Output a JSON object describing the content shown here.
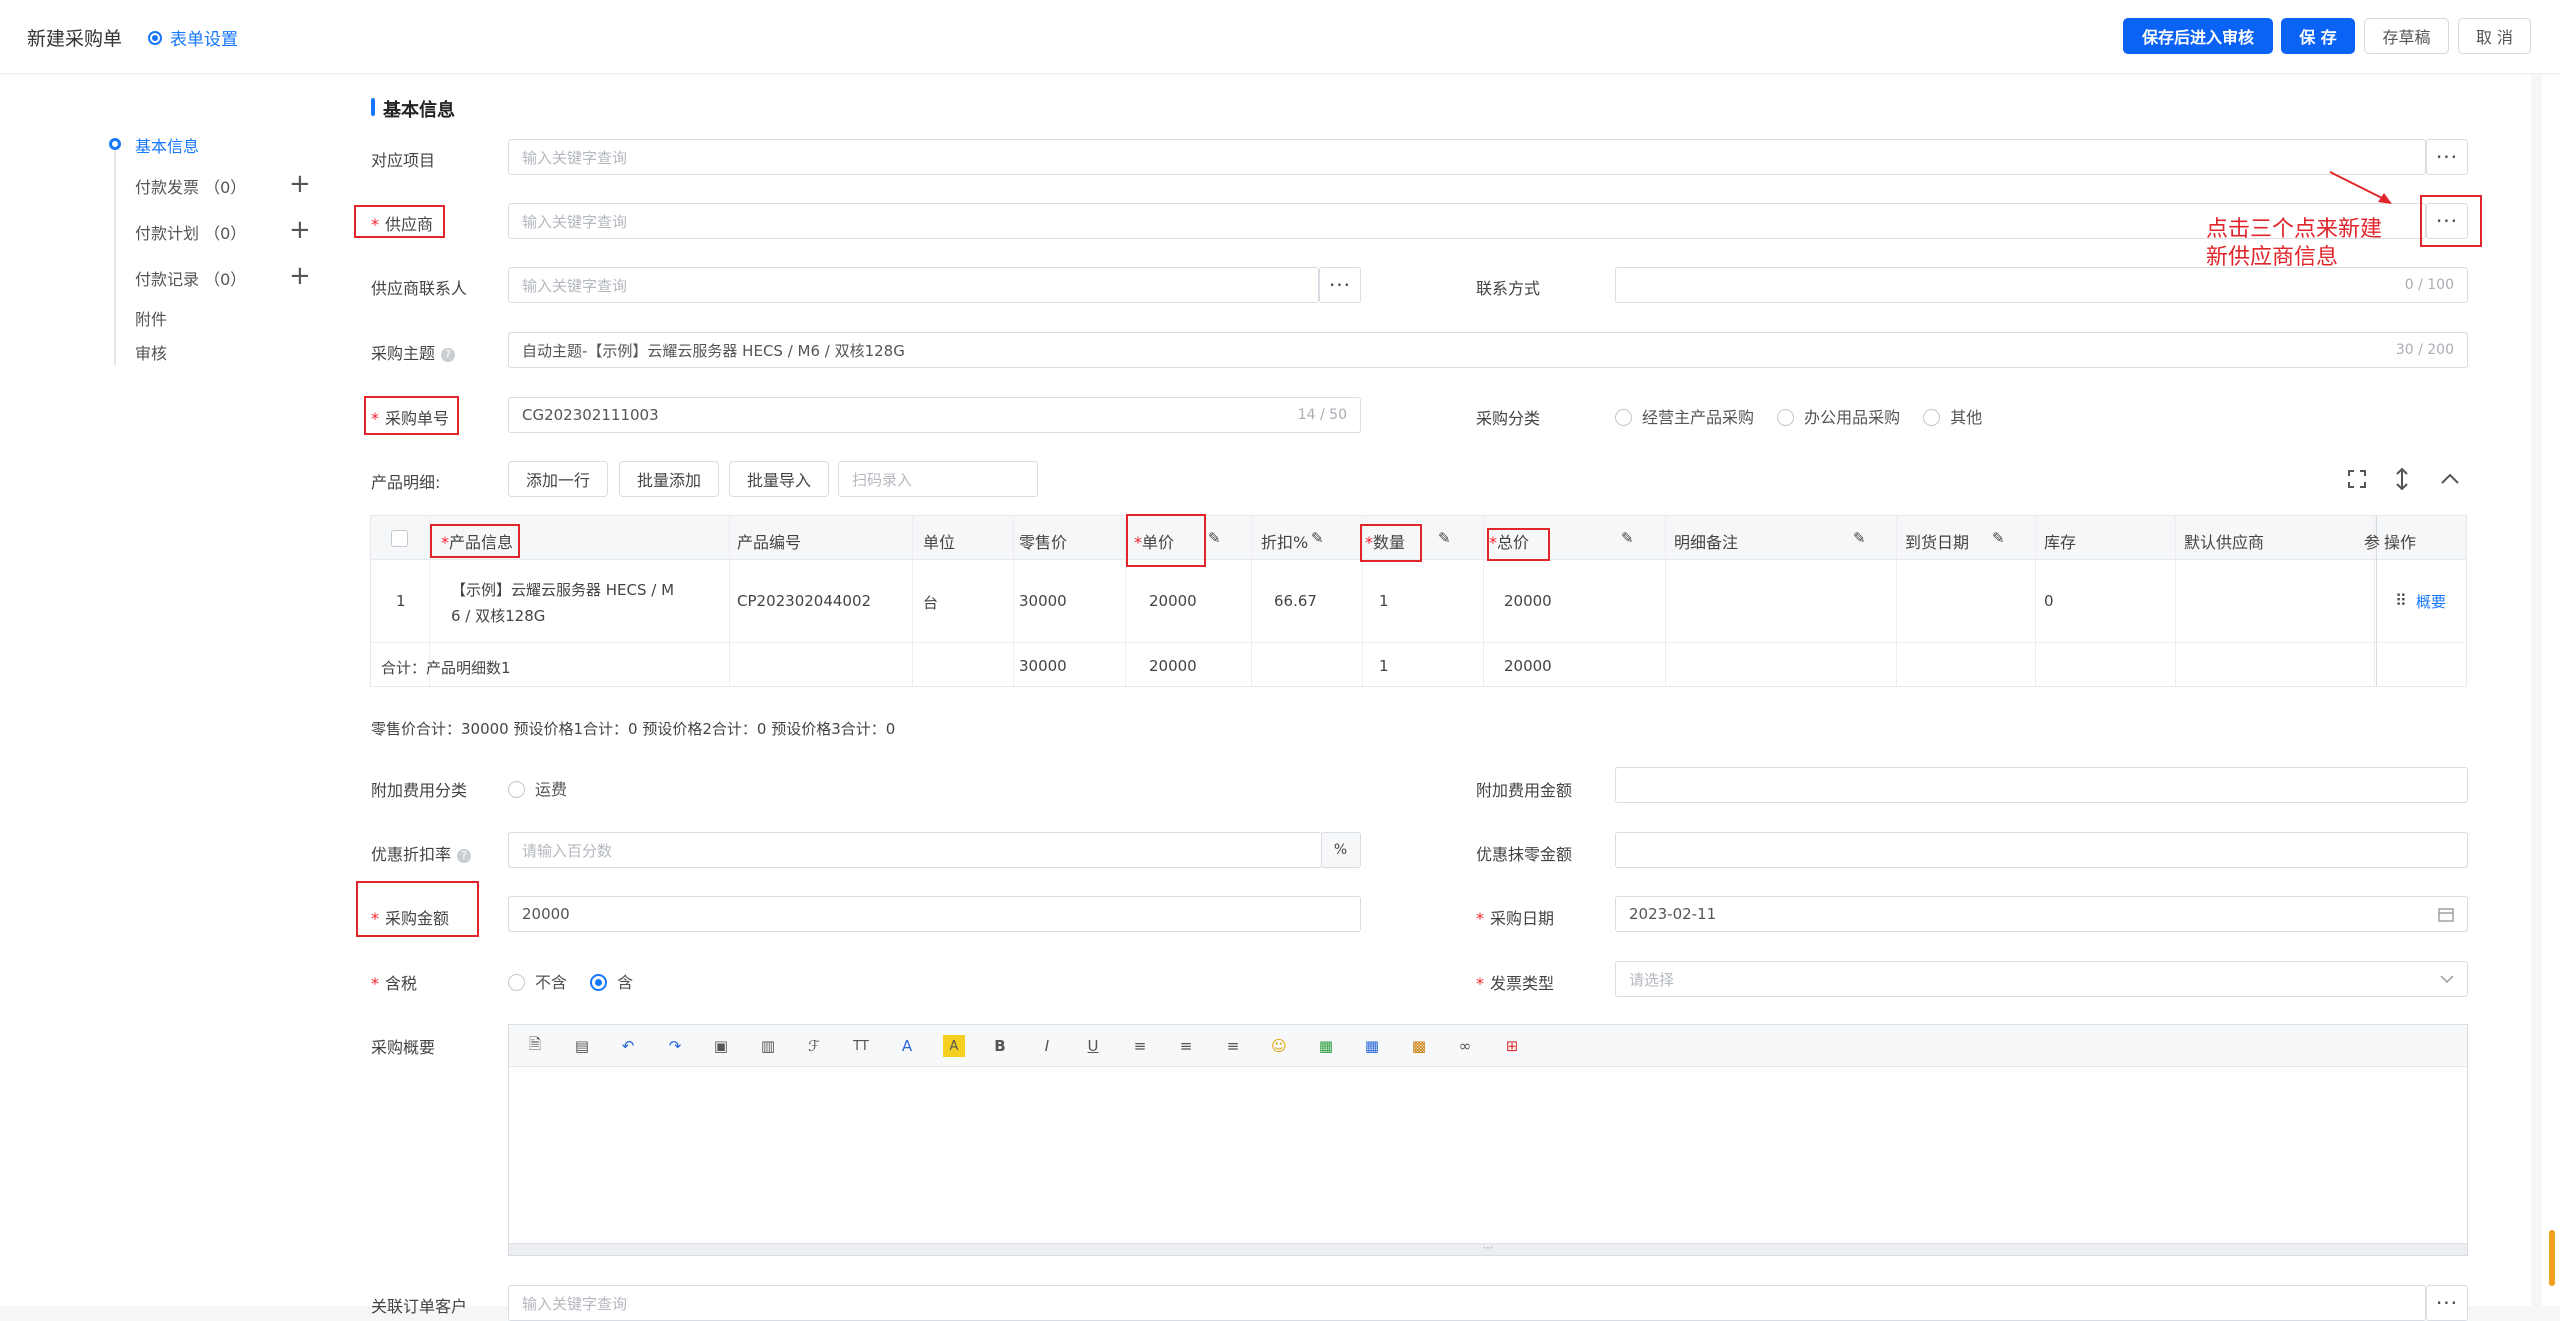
{
  "header": {
    "title": "新建采购单",
    "form_settings": "表单设置",
    "buttons": {
      "save_and_review": "保存后进入审核",
      "save": "保 存",
      "draft": "存草稿",
      "cancel": "取 消"
    }
  },
  "sidebar": {
    "items": [
      {
        "label": "基本信息"
      },
      {
        "label": "付款发票 （0）"
      },
      {
        "label": "付款计划 （0）"
      },
      {
        "label": "付款记录 （0）"
      },
      {
        "label": "附件"
      },
      {
        "label": "审核"
      }
    ],
    "plus": "+"
  },
  "form": {
    "section_title": "基本信息",
    "project": {
      "label": "对应项目",
      "placeholder": "输入关键字查询"
    },
    "supplier": {
      "label": "供应商",
      "placeholder": "输入关键字查询"
    },
    "supplier_contact": {
      "label": "供应商联系人",
      "placeholder": "输入关键字查询"
    },
    "contact_method": {
      "label": "联系方式",
      "counter": "0 / 100"
    },
    "subject": {
      "label": "采购主题",
      "value": "自动主题-【示例】云耀云服务器 HECS / M6 / 双核128G",
      "counter": "30 / 200"
    },
    "order_no": {
      "label": "采购单号",
      "value": "CG202302111003",
      "counter": "14 / 50"
    },
    "category": {
      "label": "采购分类",
      "options": [
        "经营主产品采购",
        "办公用品采购",
        "其他"
      ]
    },
    "product_detail_label": "产品明细:",
    "toolbar_buttons": [
      "添加一行",
      "批量添加",
      "批量导入"
    ],
    "scan_placeholder": "扫码录入",
    "dots": "···",
    "required_mark": "*"
  },
  "table": {
    "headers": [
      "产品信息",
      "产品编号",
      "单位",
      "零售价",
      "单价",
      "折扣%",
      "数量",
      "总价",
      "明细备注",
      "到货日期",
      "库存",
      "默认供应商",
      "参",
      "操作"
    ],
    "row": {
      "index": "1",
      "product_line1": "【示例】云耀云服务器 HECS / M",
      "product_line2": "6 / 双核128G",
      "code": "CP202302044002",
      "unit": "台",
      "retail": "30000",
      "price": "20000",
      "discount": "66.67",
      "qty": "1",
      "total": "20000",
      "stock": "0",
      "action": "概要"
    },
    "summary": {
      "label": "合计：产品明细数1",
      "retail": "30000",
      "price": "20000",
      "qty": "1",
      "total": "20000"
    }
  },
  "totals_line": "零售价合计：30000  预设价格1合计：0  预设价格2合计：0  预设价格3合计：0",
  "fees": {
    "category_label": "附加费用分类",
    "category_option": "运费",
    "amount_label": "附加费用金额",
    "discount_rate_label": "优惠折扣率",
    "discount_rate_placeholder": "请输入百分数",
    "percent": "%",
    "rounding_label": "优惠抹零金额"
  },
  "purchase": {
    "amount_label": "采购金额",
    "amount_value": "20000",
    "date_label": "采购日期",
    "date_value": "2023-02-11",
    "tax_label": "含税",
    "tax_options": [
      "不含",
      "含"
    ],
    "tax_selected": "含",
    "invoice_label": "发票类型",
    "invoice_placeholder": "请选择",
    "summary_label": "采购概要",
    "related_label": "关联订单客户",
    "related_placeholder": "输入关键字查询"
  },
  "editor_tools": [
    "source-icon",
    "template-icon",
    "undo-icon",
    "redo-icon",
    "paste-icon",
    "paste-text-icon",
    "font-family-icon",
    "font-size-icon",
    "font-color-icon",
    "highlight-icon",
    "bold-icon",
    "italic-icon",
    "underline-icon",
    "align-left-icon",
    "align-center-icon",
    "align-right-icon",
    "emoji-icon",
    "image-icon",
    "table-icon",
    "media-icon",
    "link-icon",
    "fullscreen-icon"
  ],
  "annotation": {
    "line1": "点击三个点来新建",
    "line2": "新供应商信息",
    "color": "#e0262b"
  },
  "colors": {
    "primary": "#0a63f5",
    "link": "#1677ff",
    "required": "#f5222d"
  }
}
